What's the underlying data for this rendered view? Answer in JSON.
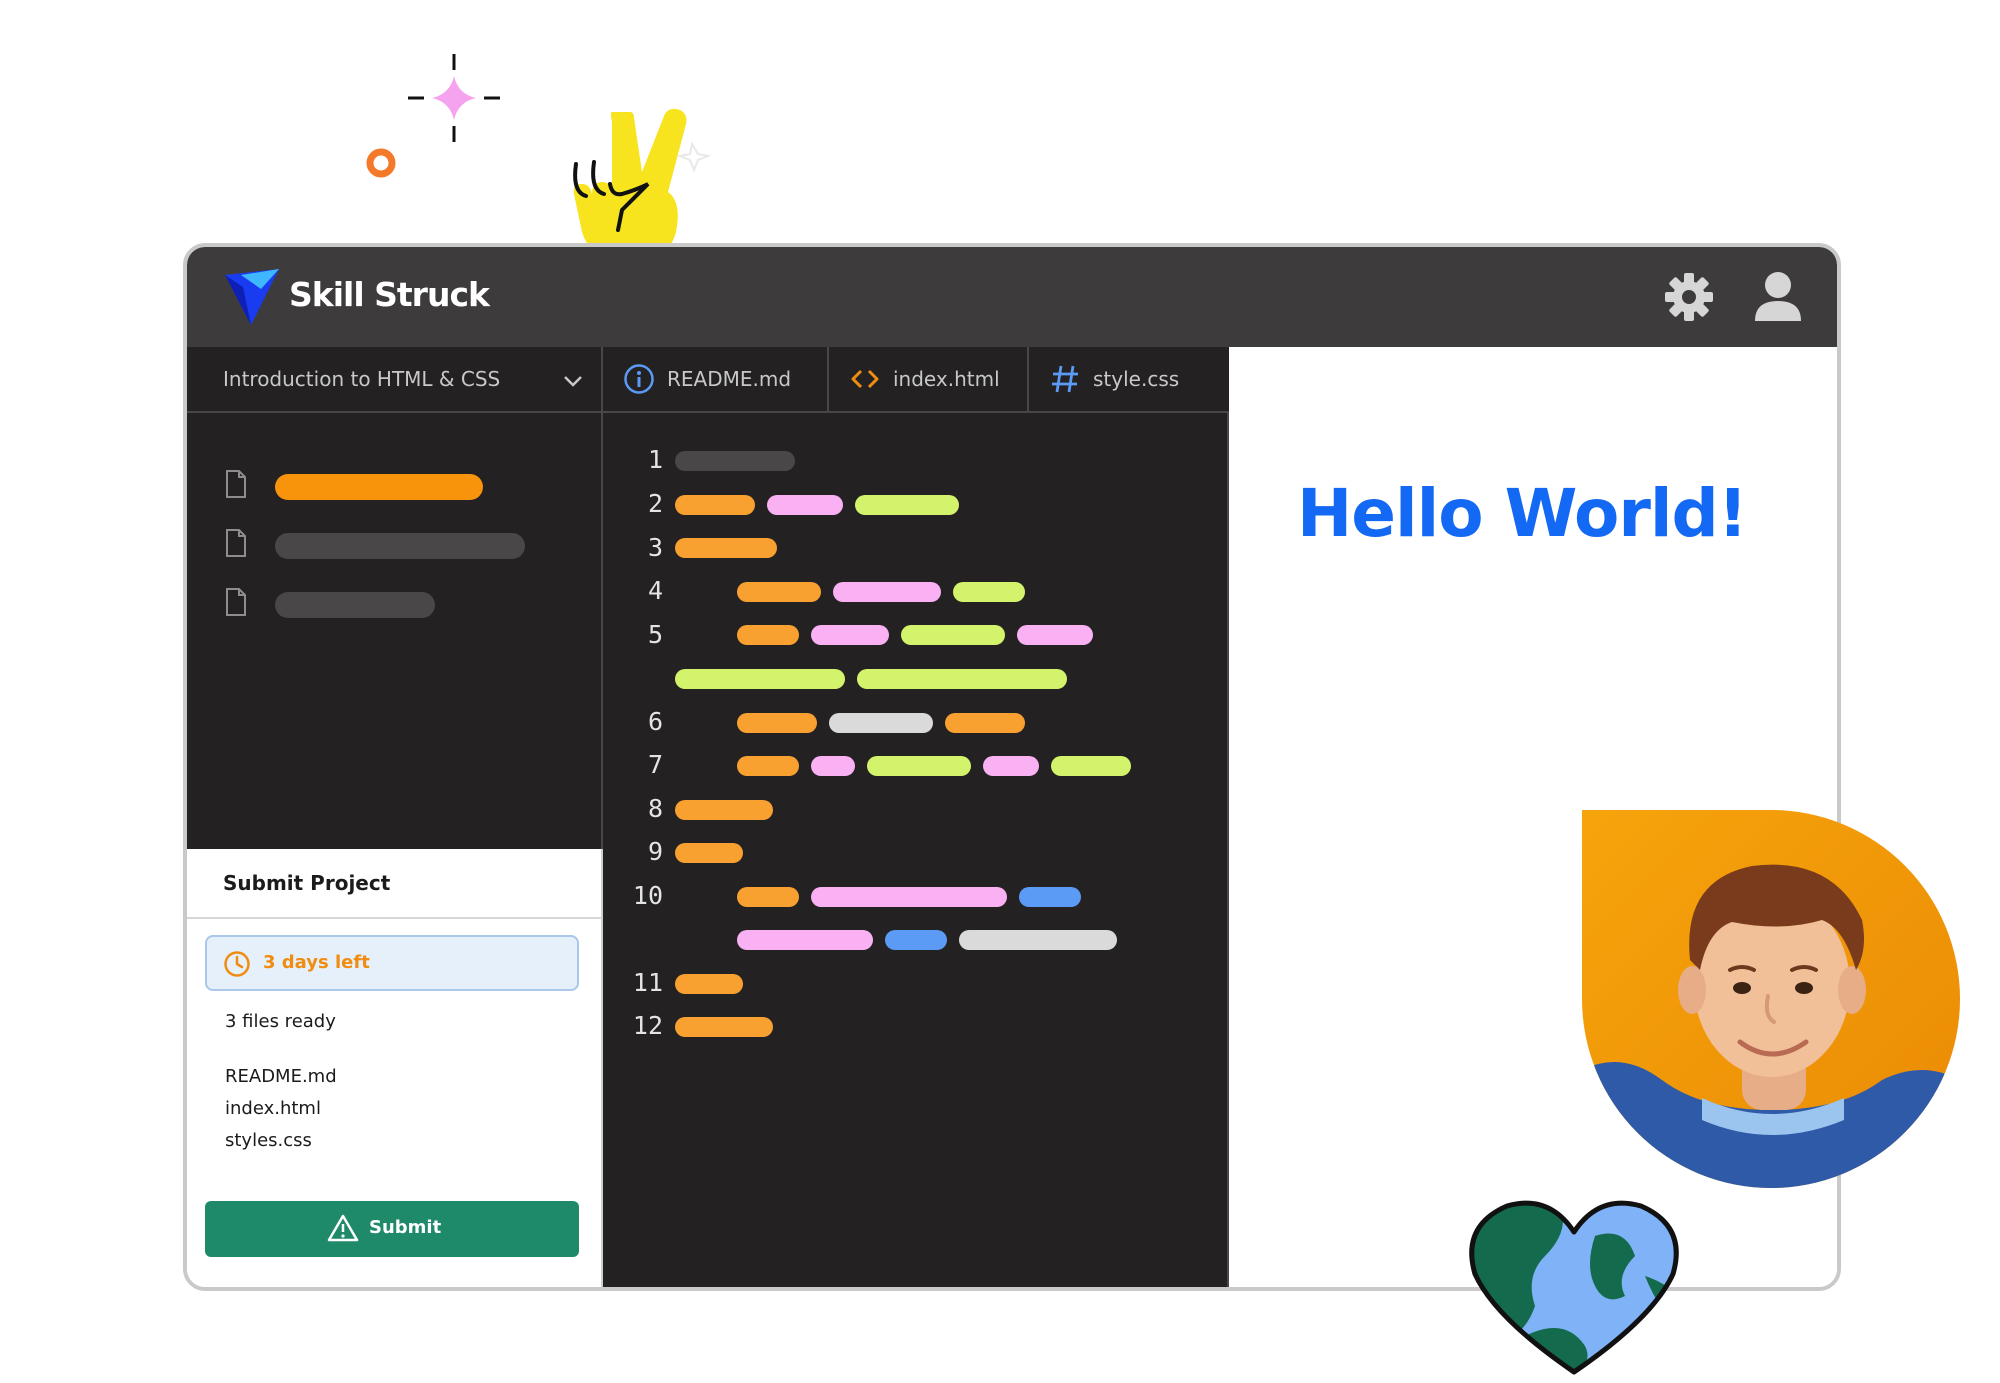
{
  "brand": {
    "name": "Skill Struck"
  },
  "header": {
    "settings_icon": "gear-icon",
    "account_icon": "user-icon"
  },
  "course": {
    "selected": "Introduction to HTML & CSS"
  },
  "tabs": [
    {
      "label": "README.md",
      "icon": "info-icon"
    },
    {
      "label": "index.html",
      "icon": "code-icon"
    },
    {
      "label": "style.css",
      "icon": "hash-icon"
    }
  ],
  "file_tree": [
    {
      "icon": "file-icon",
      "color": "#f7940b"
    },
    {
      "icon": "file-icon",
      "color": "#4a4748"
    },
    {
      "icon": "file-icon",
      "color": "#4a4748"
    }
  ],
  "editor": {
    "line_numbers": [
      "1",
      "2",
      "3",
      "4",
      "5",
      "6",
      "7",
      "8",
      "9",
      "10",
      "11",
      "12"
    ]
  },
  "submit": {
    "title": "Submit Project",
    "deadline": "3 days left",
    "files_ready": "3 files ready",
    "files": [
      "README.md",
      "index.html",
      "styles.css"
    ],
    "button_label": "Submit"
  },
  "preview": {
    "heading": "Hello World!"
  },
  "colors": {
    "accent_blue": "#1368f4",
    "submit_green": "#1f8a69",
    "deadline_orange": "#f08c10",
    "token_orange": "#f8a030",
    "token_pink": "#f9b1f4",
    "token_green": "#d3f36c",
    "token_gray": "#dadada",
    "token_blue": "#5b9af5"
  }
}
